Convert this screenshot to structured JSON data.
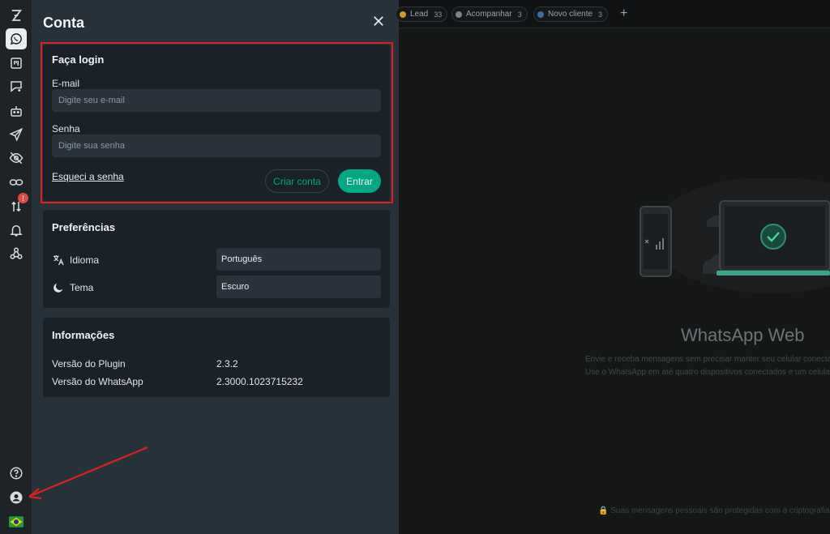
{
  "rail": {
    "items": [
      {
        "name": "logo-icon"
      },
      {
        "name": "whatsapp-icon"
      },
      {
        "name": "kanban-icon"
      },
      {
        "name": "scheduled-message-icon"
      },
      {
        "name": "bot-icon"
      },
      {
        "name": "send-icon"
      },
      {
        "name": "eye-off-icon"
      },
      {
        "name": "link-icon"
      },
      {
        "name": "transfer-icon",
        "badge": "!"
      },
      {
        "name": "bell-icon"
      },
      {
        "name": "webhook-icon"
      },
      {
        "name": "help-icon"
      },
      {
        "name": "account-icon"
      },
      {
        "name": "brazil-flag-icon"
      }
    ]
  },
  "panel": {
    "title": "Conta",
    "login": {
      "title": "Faça login",
      "email_label": "E-mail",
      "email_placeholder": "Digite seu e-mail",
      "email_value": "",
      "password_label": "Senha",
      "password_placeholder": "Digite sua senha",
      "password_value": "",
      "forgot_link": "Esqueci a senha",
      "create_account": "Criar conta",
      "login_button": "Entrar"
    },
    "preferences": {
      "title": "Preferências",
      "language_label": "Idioma",
      "language_value": "Português",
      "theme_label": "Tema",
      "theme_value": "Escuro"
    },
    "info": {
      "title": "Informações",
      "plugin_version_label": "Versão do Plugin",
      "plugin_version": "2.3.2",
      "whatsapp_version_label": "Versão do WhatsApp",
      "whatsapp_version": "2.3000.1023715232"
    }
  },
  "whatsapp": {
    "tags": [
      {
        "label": "Lead",
        "count": "33",
        "color": "#c89b2a"
      },
      {
        "label": "Acompanhar",
        "count": "3",
        "color": "#7c8288"
      },
      {
        "label": "Novo cliente",
        "count": "3",
        "color": "#3d6f9e"
      }
    ],
    "title": "WhatsApp Web",
    "desc_line1": "Envie e receba mensagens sem precisar manter seu celular conecta",
    "desc_line2": "Use o WhatsApp em até quatro dispositivos conectados e um celular a",
    "footer": "🔒 Suas mensagens pessoais são protegidas com a criptografia de p"
  },
  "colors": {
    "accent": "#00a884",
    "highlight_outline": "#e01e1e"
  }
}
